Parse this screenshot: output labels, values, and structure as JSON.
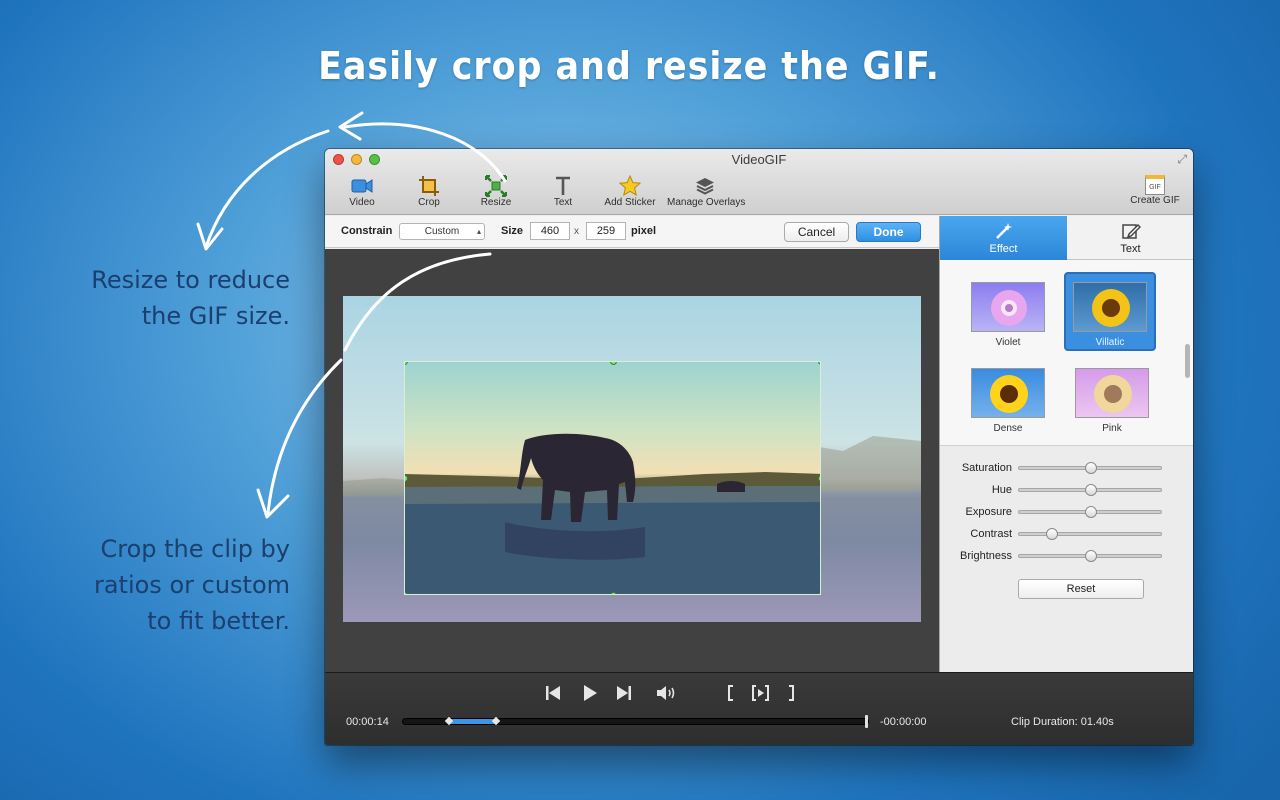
{
  "headline": "Easily crop and resize the GIF.",
  "notes": {
    "resize": [
      "Resize to reduce",
      "the GIF size."
    ],
    "crop": [
      "Crop the clip by",
      "ratios or custom",
      "to fit better."
    ]
  },
  "window": {
    "title": "VideoGIF",
    "toolbar": {
      "video": "Video",
      "crop": "Crop",
      "resize": "Resize",
      "text": "Text",
      "add_sticker": "Add Sticker",
      "manage_overlays": "Manage Overlays",
      "create_gif": "Create GIF",
      "create_gif_icon_text": "GIF"
    }
  },
  "optbar": {
    "constrain_label": "Constrain",
    "constrain_value": "Custom",
    "size_label": "Size",
    "width": "460",
    "times": "x",
    "height": "259",
    "unit": "pixel",
    "cancel": "Cancel",
    "done": "Done"
  },
  "panel": {
    "tabs": {
      "effect": "Effect",
      "text": "Text"
    },
    "effects": [
      {
        "name": "Violet",
        "selected": false
      },
      {
        "name": "Villatic",
        "selected": true
      },
      {
        "name": "Dense",
        "selected": false
      },
      {
        "name": "Pink",
        "selected": false
      }
    ],
    "adjustments": [
      {
        "label": "Saturation",
        "value": 0.5
      },
      {
        "label": "Hue",
        "value": 0.5
      },
      {
        "label": "Exposure",
        "value": 0.5
      },
      {
        "label": "Contrast",
        "value": 0.23
      },
      {
        "label": "Brightness",
        "value": 0.5
      }
    ],
    "reset": "Reset"
  },
  "player": {
    "current_time": "00:00:14",
    "remaining_time": "-00:00:00",
    "clip_duration": "Clip Duration: 01.40s"
  },
  "colors": {
    "accent": "#2f8fe3",
    "background": "#2a7fc6",
    "note_text": "#1b3f6e"
  }
}
